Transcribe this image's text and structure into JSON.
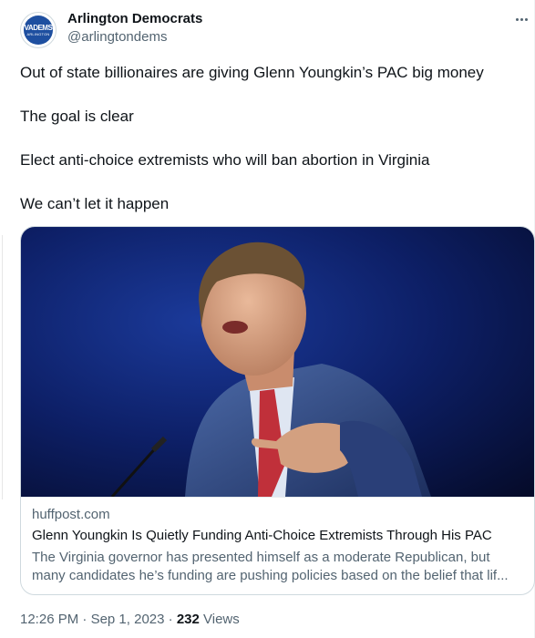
{
  "author": {
    "name": "Arlington Democrats",
    "handle": "@arlingtondems",
    "avatar_text_top": "VADEMS",
    "avatar_text_bottom": "ARLINGTON"
  },
  "tweet": {
    "lines": [
      "Out of state billionaires are giving Glenn Youngkin’s PAC big money",
      "The goal is clear",
      "Elect anti-choice extremists who will ban abortion in Virginia",
      "We can’t let it happen"
    ]
  },
  "card": {
    "domain": "huffpost.com",
    "title": "Glenn Youngkin Is Quietly Funding Anti-Choice Extremists Through His PAC",
    "description_line1": "The Virginia governor has presented himself as a moderate Republican, but",
    "description_line2": "many candidates he’s funding are pushing policies based on the belief that lif..."
  },
  "meta": {
    "time": "12:26 PM",
    "sep1": " · ",
    "date": "Sep 1, 2023",
    "sep2": " · ",
    "views_count": "232",
    "views_label": " Views"
  },
  "icons": {
    "more": "more-dots-icon"
  },
  "colors": {
    "text_primary": "#0f1419",
    "text_secondary": "#536471",
    "border": "#cfd9de",
    "avatar_blue": "#1e4fa0"
  }
}
